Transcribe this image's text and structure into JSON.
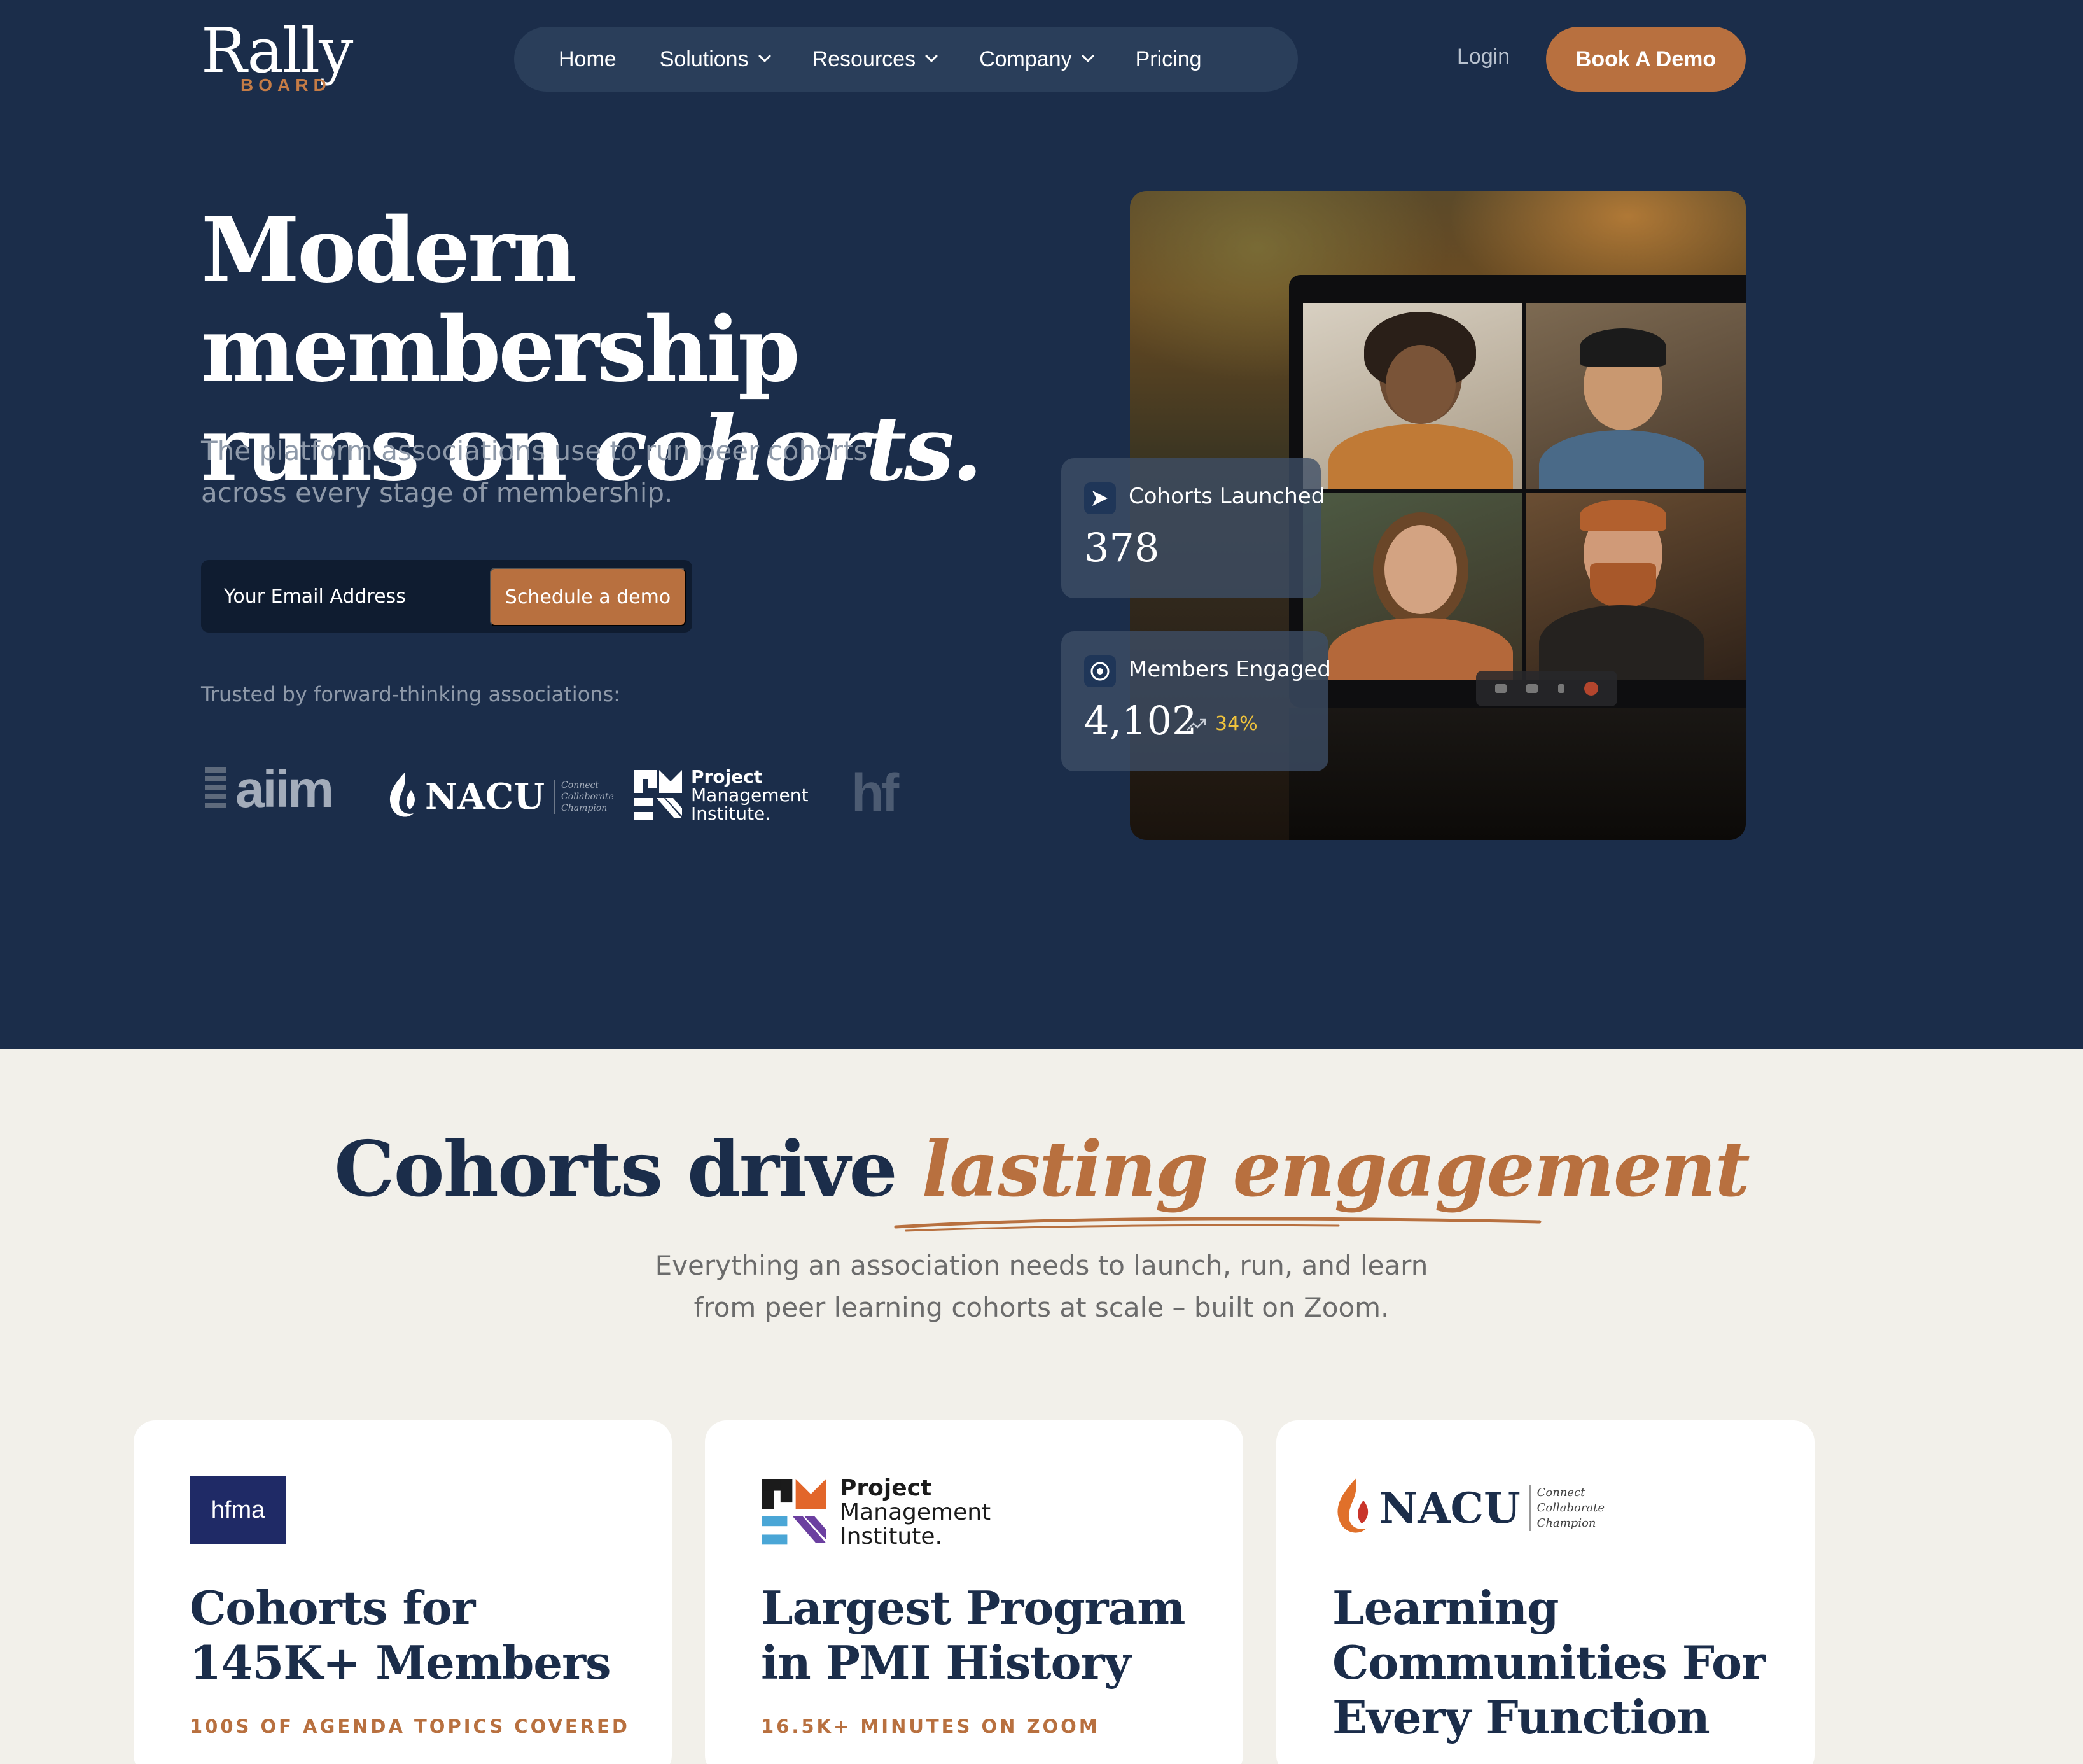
{
  "brand": {
    "name": "Rally",
    "sub": "BOARD",
    "accent": "#b8703f",
    "navy": "#1b2d4a"
  },
  "nav": {
    "items": [
      {
        "label": "Home",
        "has_menu": false
      },
      {
        "label": "Solutions",
        "has_menu": true
      },
      {
        "label": "Resources",
        "has_menu": true
      },
      {
        "label": "Company",
        "has_menu": true
      },
      {
        "label": "Pricing",
        "has_menu": false
      }
    ],
    "login": "Login",
    "cta": "Book A Demo"
  },
  "hero": {
    "title_line1": "Modern membership",
    "title_line2_plain": "runs on ",
    "title_line2_italic": "cohorts.",
    "subtitle": "The platform associations use to run peer cohorts across every stage of membership.",
    "email_placeholder": "Your Email Address",
    "email_button": "Schedule a demo",
    "trusted": "Trusted by forward-thinking associations:",
    "logos": {
      "aiim": "aiim",
      "nacu": {
        "name": "NACU",
        "tag1": "Connect",
        "tag2": "Collaborate",
        "tag3": "Champion"
      },
      "pmi": {
        "line1": "Project",
        "line2": "Management",
        "line3": "Institute."
      },
      "hf": "hf"
    }
  },
  "stats": [
    {
      "label": "Cohorts Launched",
      "value": "378",
      "icon": "send-icon"
    },
    {
      "label": "Members Engaged",
      "value": "4,102",
      "trend": "34%",
      "icon": "chrome-icon"
    }
  ],
  "section": {
    "title_plain": "Cohorts drive ",
    "title_italic": "lasting engagement",
    "subtitle_line1": "Everything an association needs to launch, run, and learn",
    "subtitle_line2": "from peer learning cohorts at scale – built on Zoom."
  },
  "cards": [
    {
      "logo": "hfma",
      "title": "Cohorts for 145K+ Members",
      "kicker": "100S OF AGENDA TOPICS COVERED"
    },
    {
      "logo": "pmi",
      "title": "Largest Program in PMI History",
      "kicker": "16.5K+ MINUTES ON ZOOM"
    },
    {
      "logo": "nacu",
      "title": "Learning Communities For Every Function",
      "kicker": ""
    }
  ]
}
